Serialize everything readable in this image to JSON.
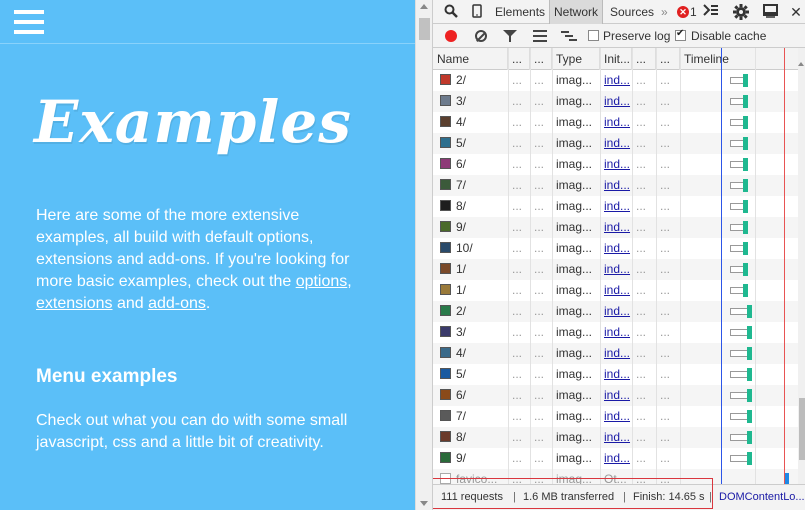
{
  "page": {
    "title": "Examples",
    "intro_text": "Here are some of the more extensive examples, all build with default options, extensions and add-ons. If you're looking for more basic examples, check out the ",
    "intro_link_options": "options",
    "intro_sep": ",",
    "intro_link_extensions": "extensions",
    "intro_and": " and ",
    "intro_link_addons": "add-ons",
    "intro_end": ".",
    "menu_heading": "Menu examples",
    "menu_text": "Check out what you can do with some small javascript, css and a little bit of creativity."
  },
  "devtools": {
    "tabs": [
      "Elements",
      "Network",
      "Sources"
    ],
    "active_tab": "Network",
    "more_tabs_symbol": "»",
    "error_count": "1",
    "preserve_log_label": "Preserve log",
    "preserve_log_checked": false,
    "disable_cache_label": "Disable cache",
    "disable_cache_checked": true,
    "columns": [
      "Name",
      "...",
      "...",
      "Type",
      "Init...",
      "...",
      "...",
      "Timeline"
    ],
    "rows": [
      {
        "name": "2/",
        "type": "imag...",
        "initiator": "ind...",
        "thumb": "#c0392b"
      },
      {
        "name": "3/",
        "type": "imag...",
        "initiator": "ind...",
        "thumb": "#6d7b8d"
      },
      {
        "name": "4/",
        "type": "imag...",
        "initiator": "ind...",
        "thumb": "#5a3f2e"
      },
      {
        "name": "5/",
        "type": "imag...",
        "initiator": "ind...",
        "thumb": "#2e6f8e"
      },
      {
        "name": "6/",
        "type": "imag...",
        "initiator": "ind...",
        "thumb": "#8e3a78"
      },
      {
        "name": "7/",
        "type": "imag...",
        "initiator": "ind...",
        "thumb": "#3b5a3a"
      },
      {
        "name": "8/",
        "type": "imag...",
        "initiator": "ind...",
        "thumb": "#1e1e1e"
      },
      {
        "name": "9/",
        "type": "imag...",
        "initiator": "ind...",
        "thumb": "#4a6a2a"
      },
      {
        "name": "10/",
        "type": "imag...",
        "initiator": "ind...",
        "thumb": "#2a4a6a"
      },
      {
        "name": "1/",
        "type": "imag...",
        "initiator": "ind...",
        "thumb": "#7a4a2a"
      },
      {
        "name": "1/",
        "type": "imag...",
        "initiator": "ind...",
        "thumb": "#9a7a3a"
      },
      {
        "name": "2/",
        "type": "imag...",
        "initiator": "ind...",
        "thumb": "#2a7a4a"
      },
      {
        "name": "3/",
        "type": "imag...",
        "initiator": "ind...",
        "thumb": "#3a3a6a"
      },
      {
        "name": "4/",
        "type": "imag...",
        "initiator": "ind...",
        "thumb": "#3a6a8a"
      },
      {
        "name": "5/",
        "type": "imag...",
        "initiator": "ind...",
        "thumb": "#1a5aa0"
      },
      {
        "name": "6/",
        "type": "imag...",
        "initiator": "ind...",
        "thumb": "#8a4a1a"
      },
      {
        "name": "7/",
        "type": "imag...",
        "initiator": "ind...",
        "thumb": "#5a5a5a"
      },
      {
        "name": "8/",
        "type": "imag...",
        "initiator": "ind...",
        "thumb": "#6a3a2a"
      },
      {
        "name": "9/",
        "type": "imag...",
        "initiator": "ind...",
        "thumb": "#2a6a3a"
      },
      {
        "name": "favico...",
        "type": "imag...",
        "initiator": "Ot...",
        "thumb": "#ffffff",
        "dim": true
      }
    ],
    "status": {
      "requests": "111 requests",
      "transferred": "1.6 MB transferred",
      "finish": "Finish: 14.65 s",
      "dom_content": "DOMContentLo...",
      "separator": "|"
    }
  },
  "colors": {
    "page_bg": "#5bbff8",
    "timeline_end": "#1fb890",
    "dom_line": "#2c55e8",
    "load_line": "#e85353",
    "record": "#e22222"
  }
}
